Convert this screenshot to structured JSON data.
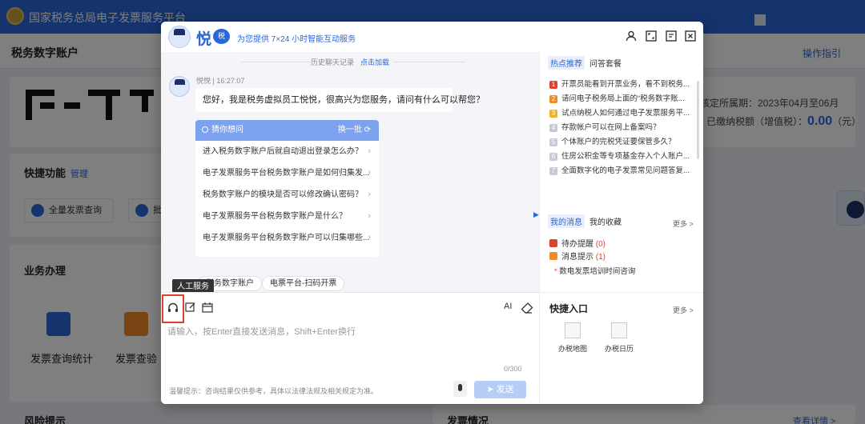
{
  "background": {
    "site_title": "国家税务总局电子发票服务平台",
    "account_title": "税务数字账户",
    "guide_link": "操作指引",
    "info_line1": "核定所属期：2023年04月至06月",
    "info_line2_label": "已缴纳税额（增值税）：",
    "info_line2_value": "0.00",
    "info_line2_unit": "（元）",
    "quick_title": "快捷功能",
    "quick_manage": "管理",
    "quick_items": [
      "全量发票查询",
      "批量..."
    ],
    "biz_title": "业务办理",
    "biz_items": [
      "发票查询统计",
      "发票查验"
    ],
    "risk_title": "风险提示",
    "invoice_status_title": "发票情况",
    "view_detail": "查看详情 >"
  },
  "modal": {
    "brand": "悦",
    "brand_badge": "税",
    "slogan": "为您提供 7×24 小时智能互动服务",
    "history_label": "历史聊天记录",
    "history_load": "点击加载",
    "bot_meta": "悦悦 | 16:27:07",
    "greeting": "您好，我是税务虚拟员工悦悦，很高兴为您服务，请问有什么可以帮您？",
    "guess_title": "猜你想问",
    "guess_swap": "换一批",
    "guess_items": [
      "进入税务数字账户后就自动退出登录怎么办？",
      "电子发票服务平台税务数字账户是如何归集发...",
      "税务数字账户的模块是否可以修改确认密码？",
      "电子发票服务平台税务数字账户是什么？",
      "电子发票服务平台税务数字账户可以归集哪些..."
    ],
    "chips": [
      "税务数字账户",
      "电票平台-扫码开票"
    ],
    "tooltip": "人工服务",
    "ai_label": "AI",
    "input_placeholder": "请输入，按Enter直接发送消息，Shift+Enter换行",
    "counter": "0/300",
    "hint": "温馨提示：咨询结果仅供参考，具体以法律法规及相关规定为准。",
    "send_label": "发送"
  },
  "side": {
    "tab_hot": "热点推荐",
    "tab_qa": "问答套餐",
    "hot_items": [
      {
        "n": "1",
        "text": "开票员能看到开票业务，看不到税务...",
        "color": "#e0412f"
      },
      {
        "n": "2",
        "text": "请问电子税务局上面的“税务数字账...",
        "color": "#f08a24"
      },
      {
        "n": "3",
        "text": "试点纳税人如何通过电子发票服务平...",
        "color": "#f0b224"
      },
      {
        "n": "4",
        "text": "存款帐户可以在网上备案吗？",
        "color": "#c6cad6"
      },
      {
        "n": "5",
        "text": "个体账户的完税凭证要保管多久？",
        "color": "#c6cad6"
      },
      {
        "n": "6",
        "text": "住房公积金等专项基金存入个人账户...",
        "color": "#c6cad6"
      },
      {
        "n": "7",
        "text": "全面数字化的电子发票常见问题答复...",
        "color": "#c6cad6"
      }
    ],
    "tab_msg": "我的消息",
    "tab_fav": "我的收藏",
    "more": "更多 >",
    "todo_label": "待办提醒",
    "todo_count": "(0)",
    "notice_label": "消息提示",
    "notice_count": "(1)",
    "notice_item": "数电发票培训时间咨询",
    "quick_entry_title": "快捷入口",
    "quick_entries": [
      "办税地图",
      "办税日历"
    ]
  }
}
